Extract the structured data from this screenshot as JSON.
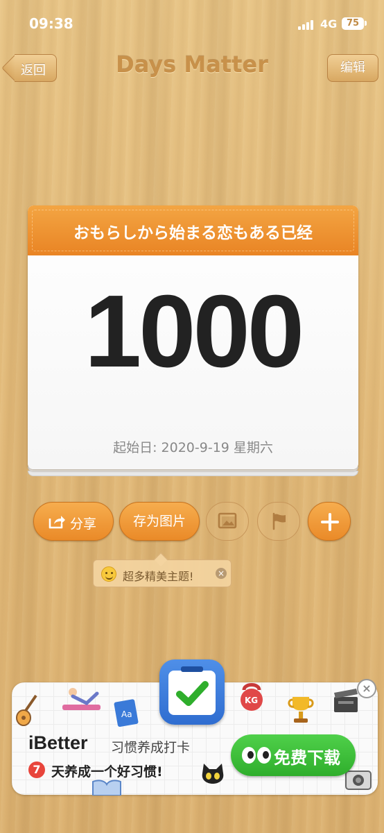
{
  "status_bar": {
    "time": "09:38",
    "network": "4G",
    "battery": "75"
  },
  "nav": {
    "back_label": "返回",
    "title": "Days Matter",
    "edit_label": "编辑"
  },
  "card": {
    "title": "おもらしから始まる恋もある已经",
    "count": "1000",
    "start_date": "起始日: 2020-9-19 星期六"
  },
  "actions": {
    "share_label": "分享",
    "save_image_label": "存为图片",
    "icons": [
      "share-icon",
      "image-icon",
      "flag-icon",
      "plus-icon"
    ]
  },
  "tooltip": {
    "text": "超多精美主题!"
  },
  "ad": {
    "app_name": "iBetter",
    "tagline": "习惯养成打卡",
    "days_badge": "7",
    "description": "天养成一个好习惯!",
    "cta_label": "免费下载"
  },
  "colors": {
    "accent_orange": "#ea8a28",
    "wood": "#e3bd7e",
    "cta_green": "#2fae2c",
    "app_blue": "#2f6dd0"
  }
}
